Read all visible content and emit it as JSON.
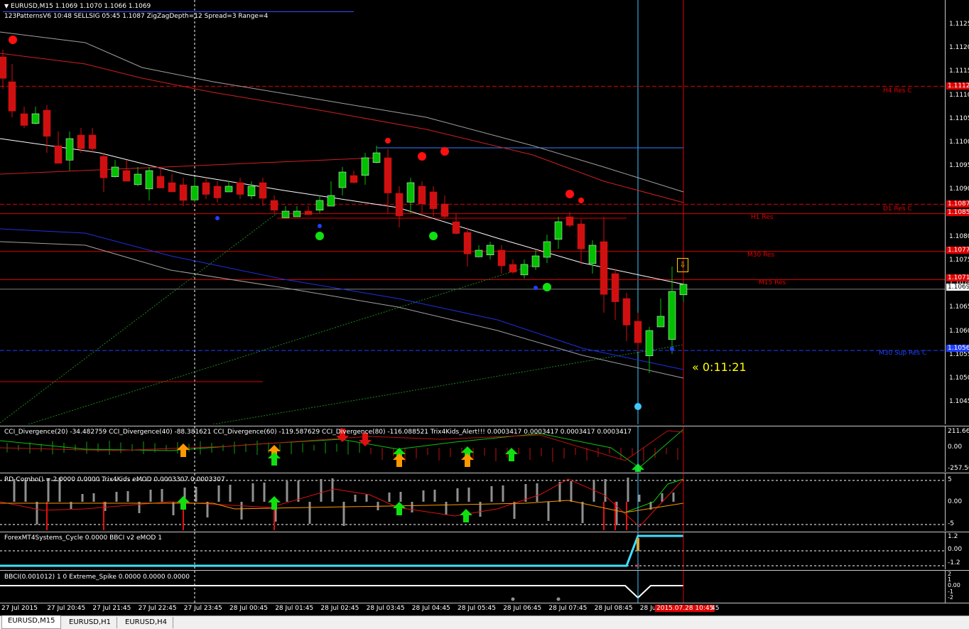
{
  "chart": {
    "title": "EURUSD,M15  1.1069 1.1070 1.1066 1.1069",
    "indicator_line": "123PatternsV6  10:48  SELLSIG  05:45  1.1087  ZigZagDepth=12  Spread=3  Range=4",
    "countdown": "« 0:11:21",
    "price_ticks": [
      "1.1125",
      "1.1120",
      "1.1115",
      "1.1110",
      "1.1105",
      "1.1100",
      "1.1095",
      "1.1090",
      "1.1085",
      "1.1080",
      "1.1075",
      "1.1070",
      "1.1065",
      "1.1060",
      "1.1055",
      "1.1050",
      "1.1045"
    ],
    "price_tags": {
      "h4": "1.1112",
      "d1": "1.1087",
      "h1": "1.1085",
      "m30": "1.1077",
      "m15": "1.1071",
      "current": "1.1069",
      "blue": "1.1056"
    },
    "levels": {
      "h4": "H4 Res C",
      "d1": "D1 Res C",
      "h1": "H1 Res",
      "m30": "M30 Res",
      "m15": "M15 Res",
      "m30_blue": "M30 Sup Res C"
    },
    "time_labels": [
      "27 Jul 2015",
      "27 Jul 20:45",
      "27 Jul 21:45",
      "27 Jul 22:45",
      "27 Jul 23:45",
      "28 Jul 00:45",
      "28 Jul 01:45",
      "28 Jul 02:45",
      "28 Jul 03:45",
      "28 Jul 04:45",
      "28 Jul 05:45",
      "28 Jul 06:45",
      "28 Jul 07:45",
      "28 Jul 08:45",
      "28 Jul"
    ],
    "time_cursor": "2015.07.28 10:45",
    "time_suffix": "45"
  },
  "subpanels": [
    {
      "header": "CCI_Divergence(20) -34.482759  CCI_Divergence(40) -88.381621  CCI_Divergence(60) -119.587629  CCI_Divergence(80) -116.088521  Trix4Kids_Alert!!! 0.0003417 0.0003417 0.0003417 0.0003417",
      "ticks": [
        "211.664",
        "0.00",
        "-257.50"
      ]
    },
    {
      "header": "RD-Combo() = 2.0000 0.0000  Trix4Kids eMOD 0.0003307 0.0003307",
      "ticks": [
        "5",
        "0.00",
        "-5"
      ]
    },
    {
      "header": "ForexMT4Systems_Cycle 0.0000  BBCI v2 eMOD 1",
      "ticks": [
        "1.2",
        "0.00",
        "-1.2"
      ]
    },
    {
      "header": "BBCI(0.001012) 1 0  Extreme_Spike 0.0000 0.0000 0.0000",
      "ticks": [
        "2",
        "1",
        "0.00",
        "-1",
        "-2"
      ]
    }
  ],
  "tabs": [
    "EURUSD,M15",
    "EURUSD,H1",
    "EURUSD,H4"
  ],
  "colors": {
    "bull": "#00c000",
    "bear": "#d01010",
    "level_red": "#e00000",
    "cyan": "#40c8ff",
    "tag_bg": "#e00000"
  }
}
